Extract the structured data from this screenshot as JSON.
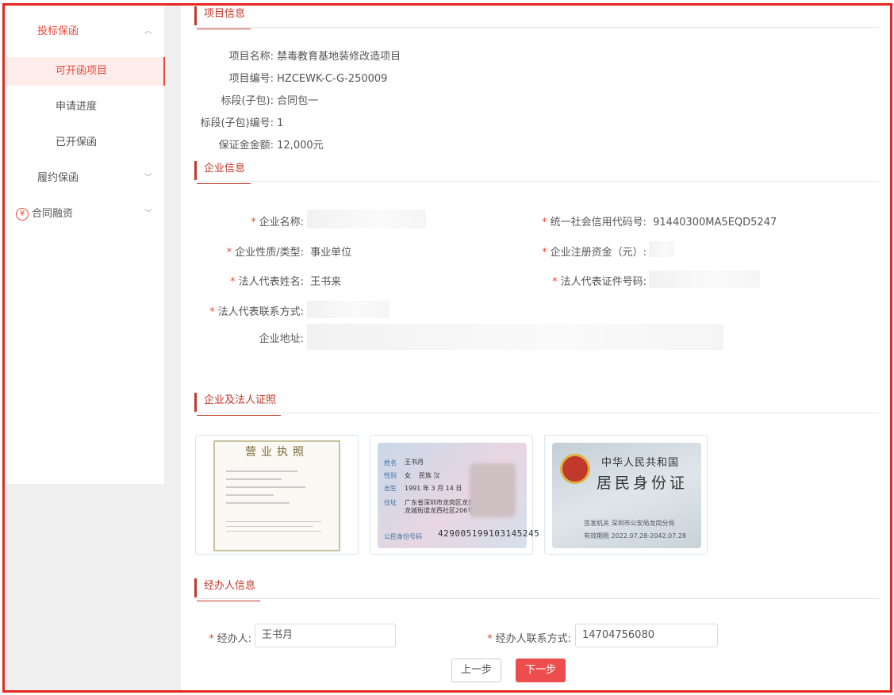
{
  "sidebar": {
    "group1": "投标保函",
    "sub1": "可开函项目",
    "sub2": "申请进度",
    "sub3": "已开保函",
    "group2": "履约保函",
    "group3": "合同融资",
    "yen_glyph": "¥"
  },
  "project": {
    "title": "项目信息",
    "name_label": "项目名称:",
    "name": "禁毒教育基地装修改造项目",
    "code_label": "项目编号:",
    "code": "HZCEWK-C-G-250009",
    "section_label": "标段(子包):",
    "section": "合同包一",
    "section_code_label": "标段(子包)编号:",
    "section_code": "1",
    "amount_label": "保证金金额:",
    "amount": "12,000元"
  },
  "company": {
    "title": "企业信息",
    "required_mark": "*",
    "name_label": "企业名称:",
    "credit_label": "统一社会信用代码号:",
    "credit": "91440300MA5EQD5247",
    "type_label": "企业性质/类型:",
    "type": "事业单位",
    "capital_label": "企业注册资金（元）:",
    "rep_label": "法人代表姓名:",
    "rep": "王书来",
    "rep_id_label": "法人代表证件号码:",
    "rep_contact_label": "法人代表联系方式:",
    "address_label": "企业地址:"
  },
  "certs": {
    "title": "企业及法人证照",
    "license_title": "营业执照",
    "id_front": {
      "name_label": "姓名",
      "name": "王书月",
      "sex_label": "性别",
      "sex": "女",
      "ethnic": "民族 汉",
      "birth_label": "出生",
      "birth": "1991 年 3 月 14 日",
      "addr_label": "住址",
      "addr1": "广东省深圳市龙岗区龙岗",
      "addr2": "龙城街道龙西社区206号",
      "id_label": "公民身份号码",
      "id": "429005199103145245"
    },
    "id_back": {
      "country": "中华人民共和国",
      "card": "居民身份证",
      "authority": "签发机关  深圳市公安局龙岗分局",
      "valid": "有效期限  2022.07.28-2042.07.28"
    }
  },
  "agent": {
    "title": "经办人信息",
    "required_mark": "*",
    "name_label": "经办人:",
    "name": "王书月",
    "phone_label": "经办人联系方式:",
    "phone": "14704756080"
  },
  "actions": {
    "prev": "上一步",
    "next": "下一步"
  }
}
